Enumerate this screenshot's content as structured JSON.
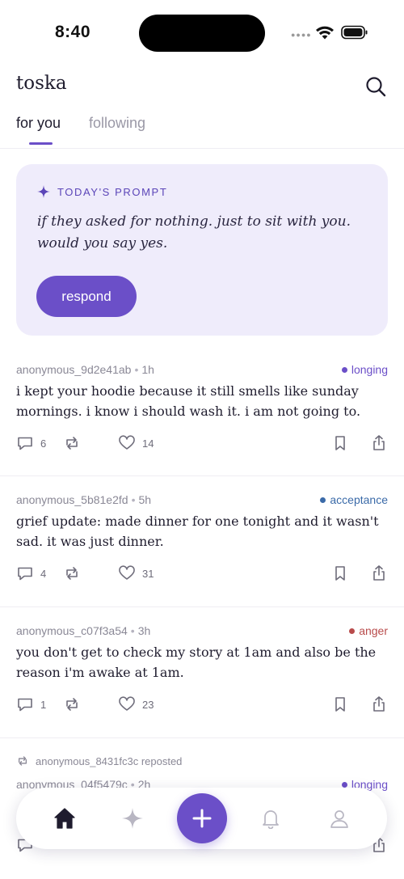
{
  "status_bar": {
    "time": "8:40"
  },
  "header": {
    "app_name": "toska",
    "tabs": [
      {
        "label": "for you",
        "active": true
      },
      {
        "label": "following",
        "active": false
      }
    ]
  },
  "prompt": {
    "label": "TODAY'S PROMPT",
    "text": "if they asked for nothing. just to sit with you. would you say yes.",
    "button": "respond"
  },
  "posts": [
    {
      "author": "anonymous_9d2e41ab",
      "time": "1h",
      "mood": "longing",
      "mood_color": "#6b4fc8",
      "body": "i kept your hoodie because it still smells like sunday mornings. i know i should wash it. i am not going to.",
      "comments": "6",
      "likes": "14"
    },
    {
      "author": "anonymous_5b81e2fd",
      "time": "5h",
      "mood": "acceptance",
      "mood_color": "#3a6aa8",
      "body": "grief update: made dinner for one tonight and it wasn't sad. it was just dinner.",
      "comments": "4",
      "likes": "31"
    },
    {
      "author": "anonymous_c07f3a54",
      "time": "3h",
      "mood": "anger",
      "mood_color": "#b84b4b",
      "body": "you don't get to check my story at 1am and also be the reason i'm awake at 1am.",
      "comments": "1",
      "likes": "23"
    },
    {
      "reposted_by": "anonymous_8431fc3c reposted",
      "author": "anonymous_04f5479c",
      "time": "2h",
      "mood": "longing",
      "mood_color": "#6b4fc8"
    }
  ],
  "colors": {
    "accent": "#6b4fc8",
    "card_bg": "#efecfb"
  },
  "nav": {
    "items": [
      "home-icon",
      "sparkle-icon",
      "plus-icon",
      "bell-icon",
      "profile-icon"
    ]
  }
}
